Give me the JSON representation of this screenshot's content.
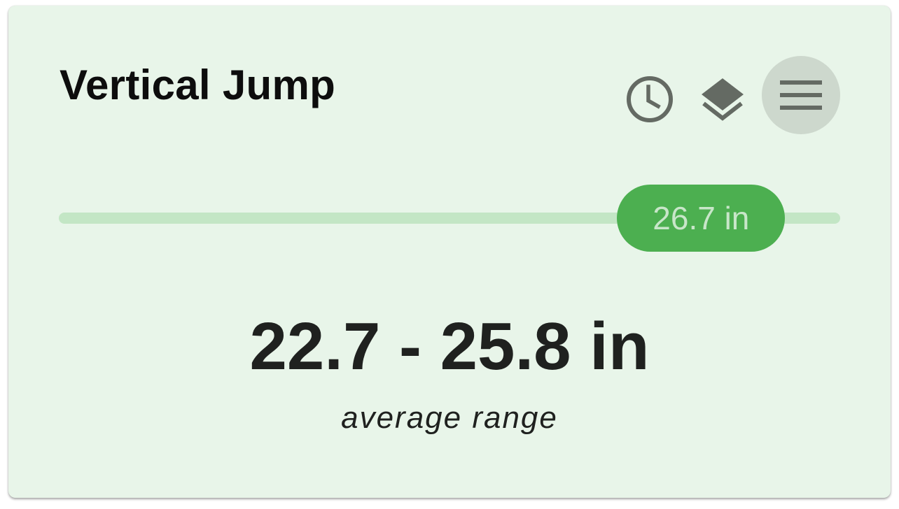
{
  "card": {
    "title": "Vertical Jump",
    "icons": {
      "history": "clock-icon",
      "layers": "layers-icon",
      "menu": "hamburger-menu-icon"
    },
    "slider": {
      "value_label": "26.7 in",
      "position_fraction": 0.822
    },
    "range": {
      "value": "22.7 - 25.8 in",
      "caption": "average range"
    },
    "colors": {
      "card_background": "#e8f5e9",
      "track": "#c3e6c5",
      "thumb": "#4caf50",
      "thumb_text": "#c8e6c9",
      "icon": "#646a63",
      "menu_button_background": "#cdd8cd"
    }
  }
}
